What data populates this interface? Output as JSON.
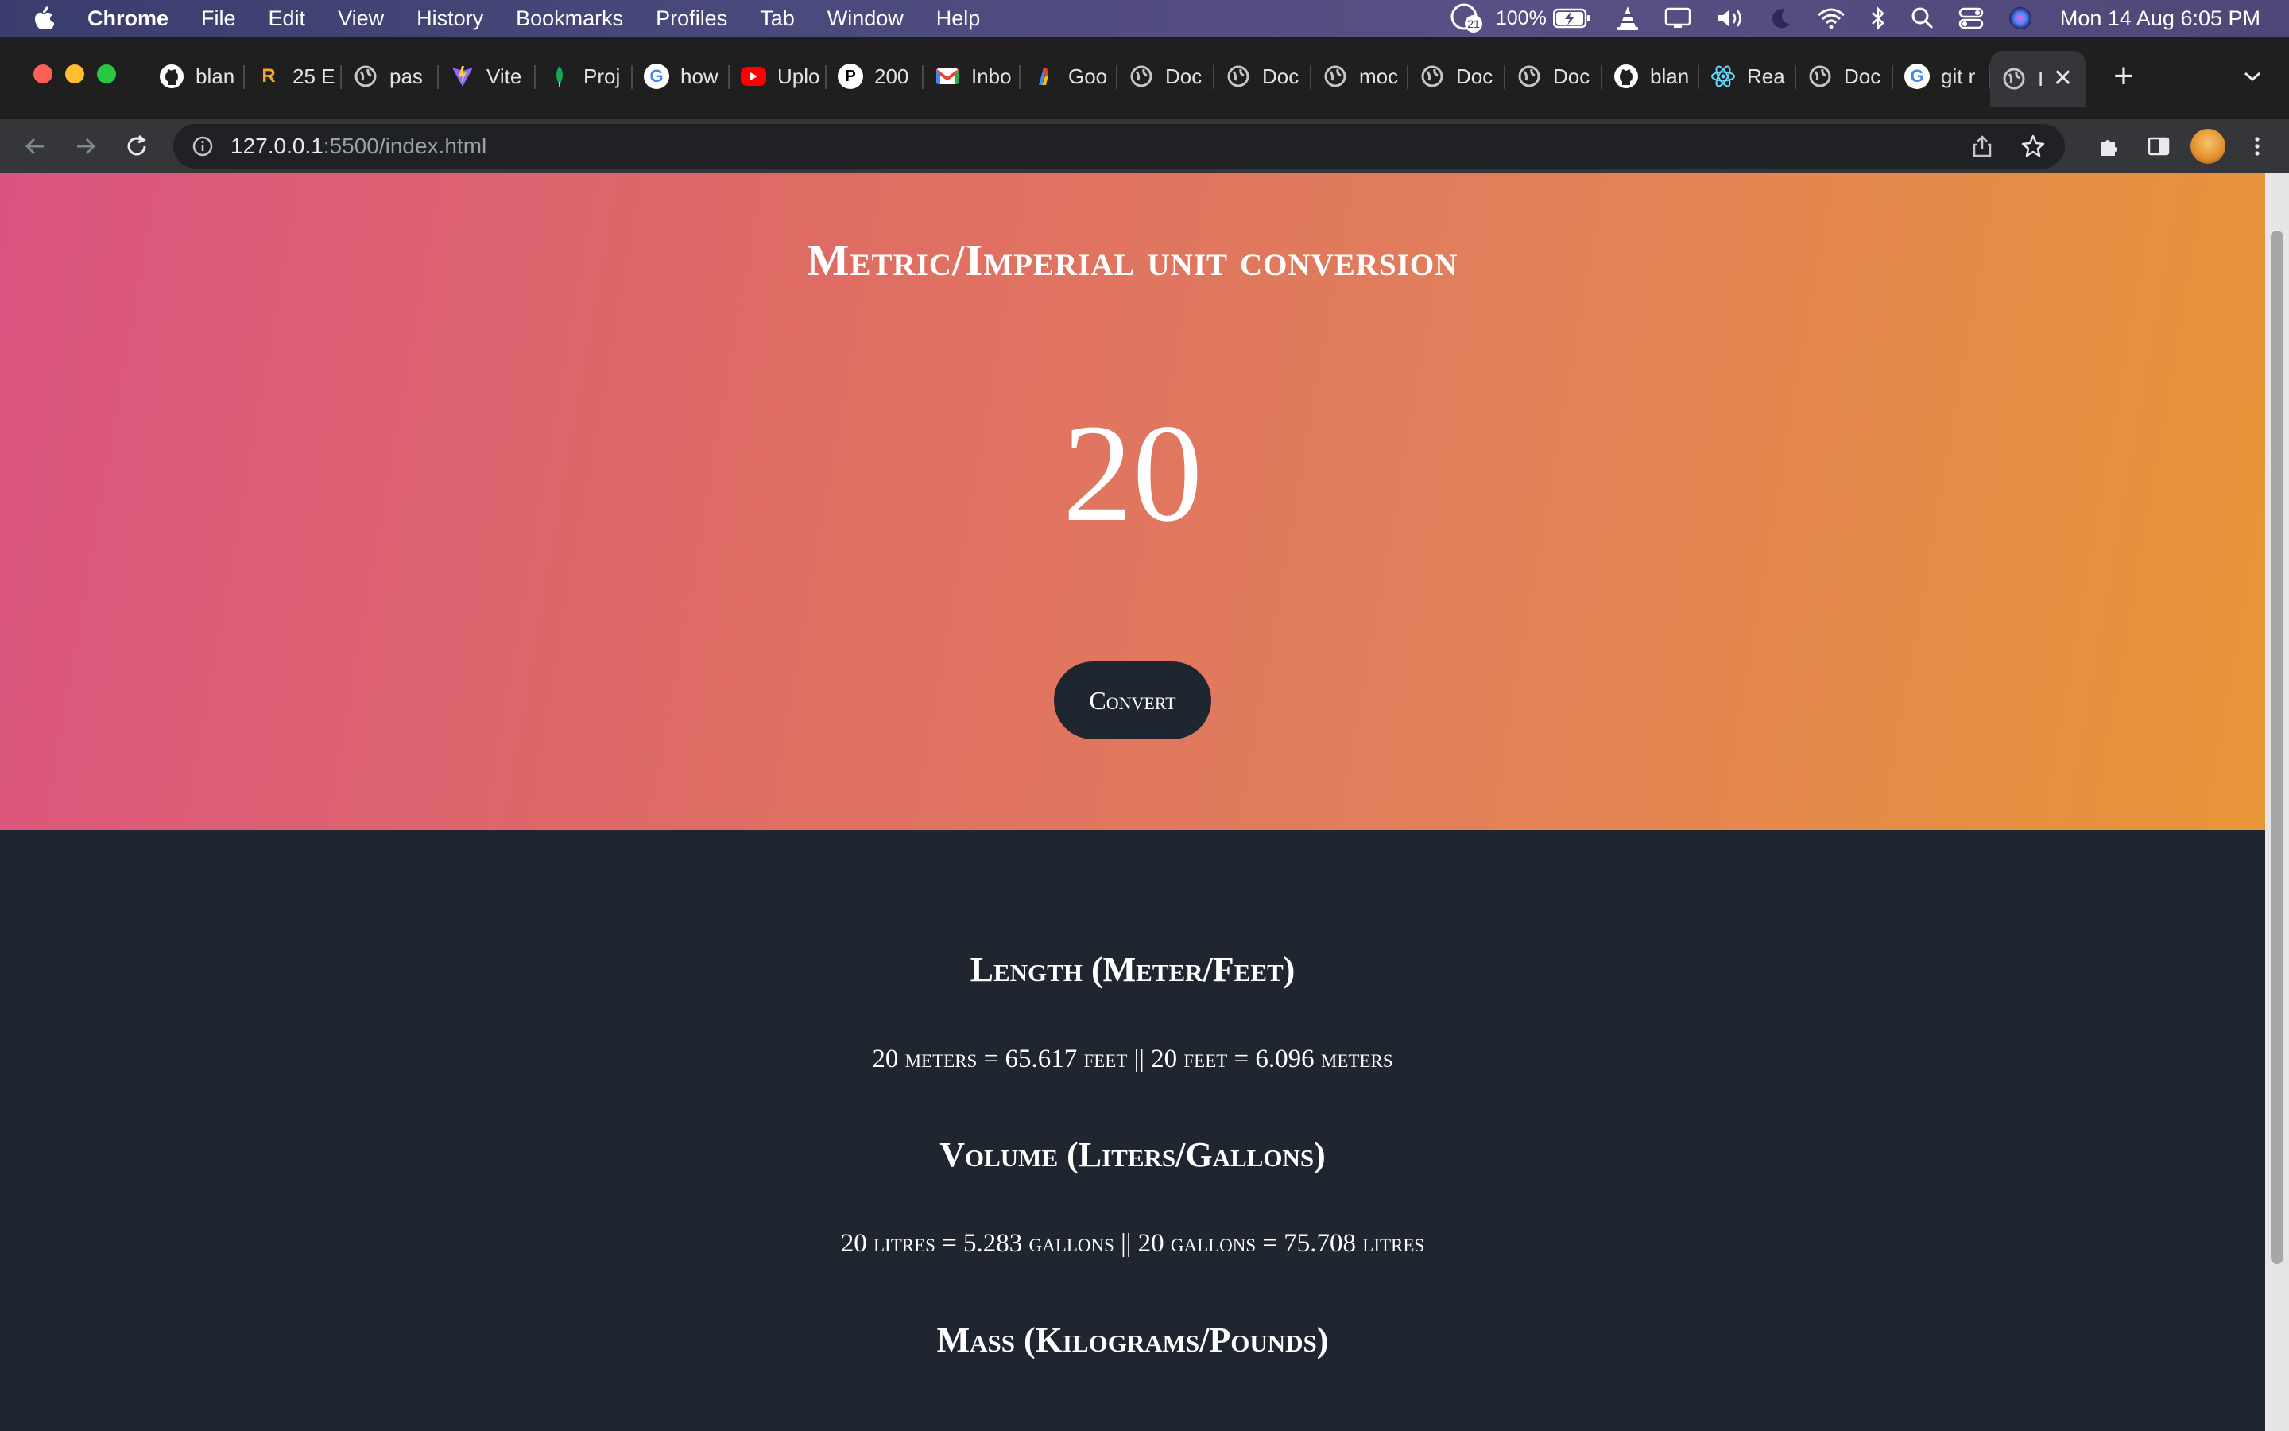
{
  "menubar": {
    "app_name": "Chrome",
    "items": [
      "File",
      "Edit",
      "View",
      "History",
      "Bookmarks",
      "Profiles",
      "Tab",
      "Window",
      "Help"
    ],
    "battery": "100%",
    "notification_count": "21",
    "clock": "Mon 14 Aug  6:05 PM"
  },
  "tabs": [
    {
      "label": "blan",
      "icon": "github-icon"
    },
    {
      "label": "25 E",
      "icon": "r-logo-icon"
    },
    {
      "label": "pas",
      "icon": "globe-icon"
    },
    {
      "label": "Vite",
      "icon": "vite-icon"
    },
    {
      "label": "Proj",
      "icon": "mongodb-leaf-icon"
    },
    {
      "label": "how",
      "icon": "google-icon"
    },
    {
      "label": "Uplo",
      "icon": "youtube-icon"
    },
    {
      "label": "200",
      "icon": "p-logo-icon"
    },
    {
      "label": "Inbo",
      "icon": "gmail-icon"
    },
    {
      "label": "Goo",
      "icon": "google-cloud-icon"
    },
    {
      "label": "Doc",
      "icon": "globe-icon"
    },
    {
      "label": "Doc",
      "icon": "globe-icon"
    },
    {
      "label": "moc",
      "icon": "globe-icon"
    },
    {
      "label": "Doc",
      "icon": "globe-icon"
    },
    {
      "label": "Doc",
      "icon": "globe-icon"
    },
    {
      "label": "blan",
      "icon": "github-icon"
    },
    {
      "label": "Rea",
      "icon": "react-icon"
    },
    {
      "label": "Doc",
      "icon": "globe-icon"
    },
    {
      "label": "git r",
      "icon": "google-icon"
    }
  ],
  "active_tab": {
    "label": "I",
    "icon": "globe-icon"
  },
  "address_bar": {
    "host": "127.0.0.1",
    "rest": ":5500/index.html"
  },
  "page": {
    "title": "Metric/Imperial unit conversion",
    "input_value": "20",
    "convert_label": "Convert",
    "sections": [
      {
        "heading": "Length (Meter/Feet)",
        "result": "20 meters = 65.617 feet || 20 feet = 6.096 meters"
      },
      {
        "heading": "Volume (Liters/Gallons)",
        "result": "20 litres = 5.283 gallons || 20 gallons = 75.708 litres"
      },
      {
        "heading": "Mass (Kilograms/Pounds)",
        "result": ""
      }
    ]
  },
  "colors": {
    "hero_gradient_start": "#da5480",
    "hero_gradient_end": "#e89537",
    "dark_bg": "#1f2630"
  }
}
